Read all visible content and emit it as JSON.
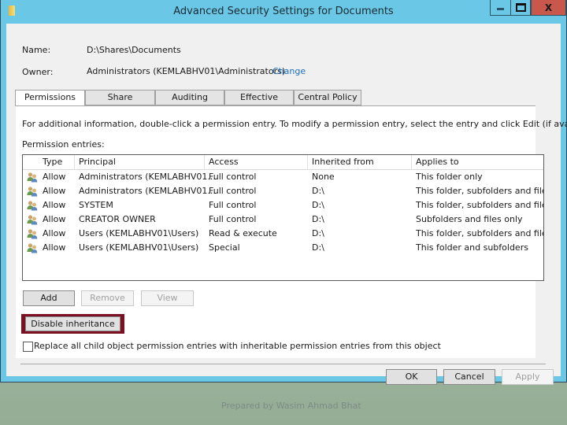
{
  "window": {
    "title": "Advanced Security Settings for Documents",
    "controls": {
      "minimize": "–",
      "maximize": "□",
      "close": "X"
    }
  },
  "info": {
    "name_label": "Name:",
    "name_value": "D:\\Shares\\Documents",
    "owner_label": "Owner:",
    "owner_value": "Administrators (KEMLABHV01\\Administrators)",
    "owner_change_link": "Change"
  },
  "tabs": [
    {
      "label": "Permissions",
      "active": true
    },
    {
      "label": "Share",
      "active": false
    },
    {
      "label": "Auditing",
      "active": false
    },
    {
      "label": "Effective Access",
      "active": false
    },
    {
      "label": "Central Policy",
      "active": false
    }
  ],
  "permissions": {
    "instructions": "For additional information, double-click a permission entry. To modify a permission entry, select the entry and click Edit (if available).",
    "entries_label": "Permission entries:",
    "columns": [
      "Type",
      "Principal",
      "Access",
      "Inherited from",
      "Applies to"
    ],
    "rows": [
      {
        "icon": "users-group-icon",
        "type": "Allow",
        "principal": "Administrators (KEMLABHV01...",
        "access": "Full control",
        "inherited_from": "None",
        "applies_to": "This folder only"
      },
      {
        "icon": "users-group-icon",
        "type": "Allow",
        "principal": "Administrators (KEMLABHV01...",
        "access": "Full control",
        "inherited_from": "D:\\",
        "applies_to": "This folder, subfolders and files"
      },
      {
        "icon": "users-group-icon",
        "type": "Allow",
        "principal": "SYSTEM",
        "access": "Full control",
        "inherited_from": "D:\\",
        "applies_to": "This folder, subfolders and files"
      },
      {
        "icon": "users-group-icon",
        "type": "Allow",
        "principal": "CREATOR OWNER",
        "access": "Full control",
        "inherited_from": "D:\\",
        "applies_to": "Subfolders and files only"
      },
      {
        "icon": "users-group-icon",
        "type": "Allow",
        "principal": "Users (KEMLABHV01\\Users)",
        "access": "Read & execute",
        "inherited_from": "D:\\",
        "applies_to": "This folder, subfolders and files"
      },
      {
        "icon": "users-group-icon",
        "type": "Allow",
        "principal": "Users (KEMLABHV01\\Users)",
        "access": "Special",
        "inherited_from": "D:\\",
        "applies_to": "This folder and subfolders"
      }
    ],
    "buttons": {
      "add": "Add",
      "remove": "Remove",
      "view": "View"
    },
    "disable_inheritance": "Disable inheritance",
    "replace_checkbox_label": "Replace all child object permission entries with inheritable permission entries from this object",
    "replace_checked": false
  },
  "footer": {
    "ok": "OK",
    "cancel": "Cancel",
    "apply": "Apply"
  },
  "slide_credit": "Prepared by Wasim Ahmad Bhat"
}
